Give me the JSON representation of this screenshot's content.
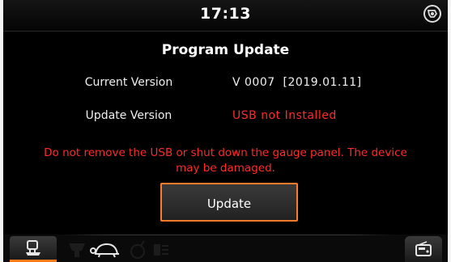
{
  "status_bar": {
    "clock": "17:13",
    "corner_icon": "service-tool-icon"
  },
  "screen": {
    "title": "Program Update",
    "rows": [
      {
        "label": "Current Version",
        "value": "V 0007  [2019.01.11]"
      },
      {
        "label": "Update Version",
        "value": "USB not Installed"
      }
    ],
    "warning": "Do not remove the USB or shut down the gauge panel. The device may be damaged.",
    "update_button": "Update"
  },
  "bottom_nav": {
    "icons": [
      "engine-icon",
      "hydraulic-icon",
      "turtle-icon",
      "hare-icon",
      "work-light-icon",
      "radio-icon"
    ],
    "active": "engine-icon"
  },
  "colors": {
    "background": "#000000",
    "text": "#ffffff",
    "warning": "#ff2a2a",
    "accent": "#ff7a2a"
  }
}
